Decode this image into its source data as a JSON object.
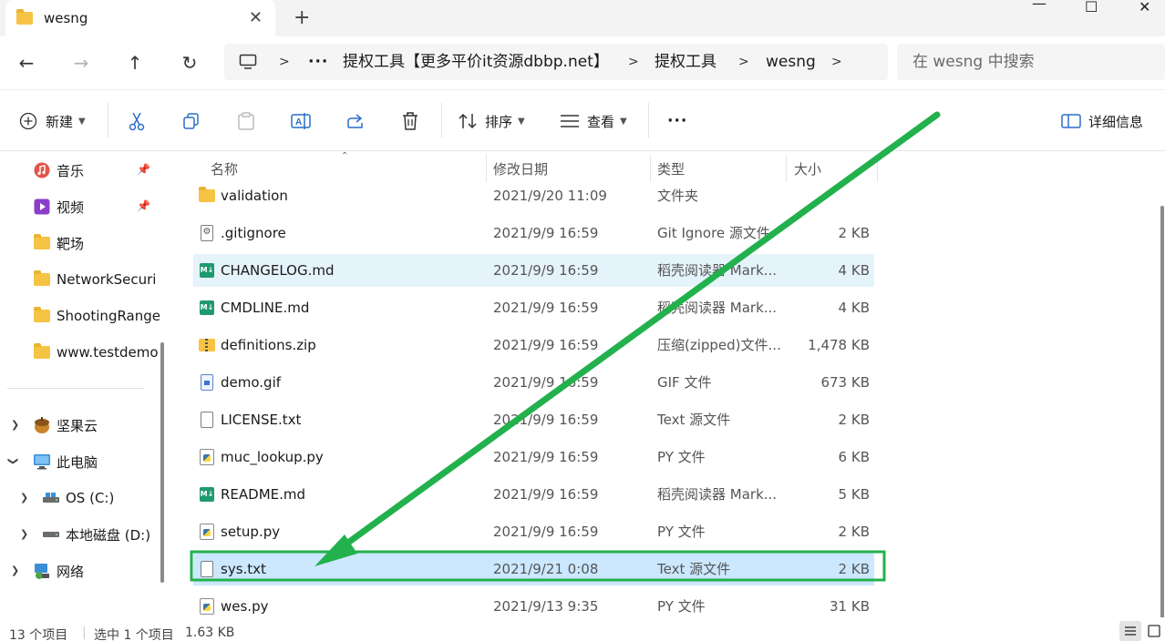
{
  "window": {
    "tab_title": "wesng",
    "tab_icon": "folder-icon",
    "new_tab_symbol": "+",
    "close_tab_symbol": "✕",
    "minimize_symbol": "—",
    "maximize_symbol": "☐",
    "close_symbol": "✕"
  },
  "nav": {
    "back_symbol": "←",
    "forward_symbol": "→",
    "up_symbol": "↑",
    "refresh_symbol": "↻",
    "breadcrumb": [
      "提权工具【更多平价it资源dbbp.net】",
      "提权工具",
      "wesng"
    ],
    "ellipsis": "···",
    "separator": ">",
    "search_placeholder": "在 wesng 中搜索"
  },
  "toolbar": {
    "new_label": "新建",
    "sort_label": "排序",
    "view_label": "查看",
    "more_label": "···",
    "details_label": "详细信息"
  },
  "sidebar": {
    "quick": [
      {
        "label": "音乐",
        "icon": "music-icon",
        "pinned": true
      },
      {
        "label": "视频",
        "icon": "video-icon",
        "pinned": true
      },
      {
        "label": "靶场",
        "icon": "folder-icon",
        "pinned": false
      },
      {
        "label": "NetworkSecuri",
        "icon": "folder-icon",
        "pinned": false
      },
      {
        "label": "ShootingRange",
        "icon": "folder-icon",
        "pinned": false
      },
      {
        "label": "www.testdemo",
        "icon": "folder-icon",
        "pinned": false
      }
    ],
    "tree": [
      {
        "label": "坚果云",
        "icon": "nutstore-icon",
        "expanded": false
      },
      {
        "label": "此电脑",
        "icon": "computer-icon",
        "expanded": true
      },
      {
        "label": "OS (C:)",
        "icon": "drive-icon",
        "expanded": false
      },
      {
        "label": "本地磁盘 (D:)",
        "icon": "drive-icon",
        "expanded": false
      },
      {
        "label": "网络",
        "icon": "network-icon",
        "expanded": false
      }
    ]
  },
  "columns": {
    "name": "名称",
    "date": "修改日期",
    "type": "类型",
    "size": "大小"
  },
  "files": [
    {
      "name": "validation",
      "date": "2021/9/20 11:09",
      "type": "文件夹",
      "size": "",
      "icon": "folder-icon"
    },
    {
      "name": ".gitignore",
      "date": "2021/9/9 16:59",
      "type": "Git Ignore 源文件",
      "size": "2 KB",
      "icon": "settings-file-icon"
    },
    {
      "name": "CHANGELOG.md",
      "date": "2021/9/9 16:59",
      "type": "稻壳阅读器 Mark...",
      "size": "4 KB",
      "icon": "markdown-icon"
    },
    {
      "name": "CMDLINE.md",
      "date": "2021/9/9 16:59",
      "type": "稻壳阅读器 Mark...",
      "size": "4 KB",
      "icon": "markdown-icon"
    },
    {
      "name": "definitions.zip",
      "date": "2021/9/9 16:59",
      "type": "压缩(zipped)文件...",
      "size": "1,478 KB",
      "icon": "zip-folder-icon"
    },
    {
      "name": "demo.gif",
      "date": "2021/9/9 16:59",
      "type": "GIF 文件",
      "size": "673 KB",
      "icon": "image-file-icon"
    },
    {
      "name": "LICENSE.txt",
      "date": "2021/9/9 16:59",
      "type": "Text 源文件",
      "size": "2 KB",
      "icon": "text-file-icon"
    },
    {
      "name": "muc_lookup.py",
      "date": "2021/9/9 16:59",
      "type": "PY 文件",
      "size": "6 KB",
      "icon": "python-file-icon"
    },
    {
      "name": "README.md",
      "date": "2021/9/9 16:59",
      "type": "稻壳阅读器 Mark...",
      "size": "5 KB",
      "icon": "markdown-icon"
    },
    {
      "name": "setup.py",
      "date": "2021/9/9 16:59",
      "type": "PY 文件",
      "size": "2 KB",
      "icon": "python-file-icon"
    },
    {
      "name": "sys.txt",
      "date": "2021/9/21 0:08",
      "type": "Text 源文件",
      "size": "2 KB",
      "icon": "text-file-icon"
    },
    {
      "name": "wes.py",
      "date": "2021/9/13 9:35",
      "type": "PY 文件",
      "size": "31 KB",
      "icon": "python-file-icon"
    }
  ],
  "status": {
    "item_count": "13 个项目",
    "selection": "选中 1 个项目",
    "selection_size": "1.63 KB"
  },
  "colors": {
    "annotation_green": "#22b14c",
    "selection_blue": "#cce8ff",
    "hover_blue": "#e5f3fb"
  }
}
